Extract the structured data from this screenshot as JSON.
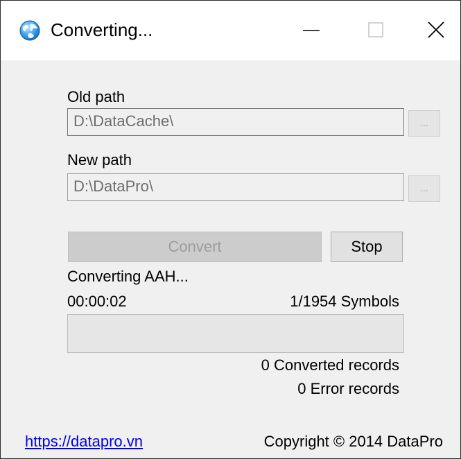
{
  "window": {
    "title": "Converting...",
    "icon": "globe-icon"
  },
  "titlebar_buttons": {
    "minimize_icon": "minimize-icon",
    "maximize_icon": "maximize-icon",
    "close_icon": "close-icon"
  },
  "form": {
    "old_path_label": "Old path",
    "old_path_value": "D:\\DataCache\\",
    "new_path_label": "New path",
    "new_path_value": "D:\\DataPro\\",
    "browse_label": "...",
    "convert_label": "Convert",
    "stop_label": "Stop"
  },
  "status": {
    "current": "Converting AAH...",
    "elapsed": "00:00:02",
    "symbols": "1/1954 Symbols",
    "progress": 0.0,
    "converted_records": "0 Converted records",
    "error_records": "0 Error records"
  },
  "footer": {
    "link": "https://datapro.vn",
    "copyright": "Copyright © 2014 DataPro"
  },
  "colors": {
    "window_bg": "#f0f0f0",
    "titlebar_bg": "#ffffff",
    "link": "#0000ee"
  }
}
